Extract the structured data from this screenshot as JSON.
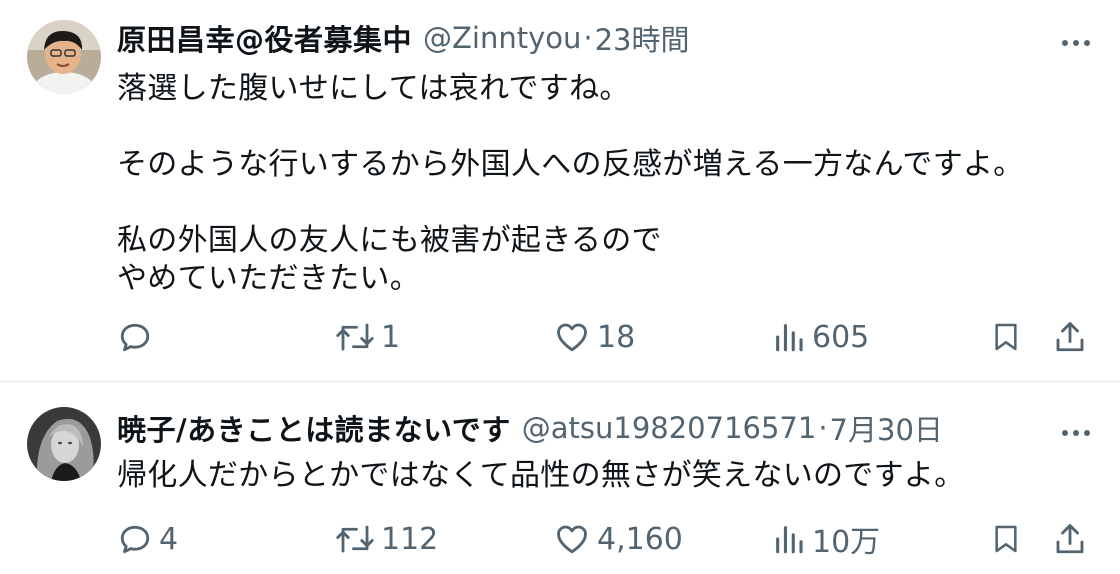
{
  "tweets": [
    {
      "name": "原田昌幸@役者募集中",
      "handle": "@Zinntyou",
      "separator": "·",
      "time": "23時間",
      "text": "落選した腹いせにしては哀れですね。\n\nそのような行いするから外国人への反感が増える一方なんですよ。\n\n私の外国人の友人にも被害が起きるので\nやめていただきたい。",
      "replies": "",
      "retweets": "1",
      "likes": "18",
      "views": "605"
    },
    {
      "name": "暁子/あきことは読まないです",
      "handle": "@atsu19820716571",
      "separator": "·",
      "time": "7月30日",
      "text": "帰化人だからとかではなくて品性の無さが笑えないのですよ。",
      "replies": "4",
      "retweets": "112",
      "likes": "4,160",
      "views": "10万"
    }
  ],
  "icons": {
    "reply": "reply-icon",
    "retweet": "retweet-icon",
    "like": "heart-icon",
    "views": "views-icon",
    "bookmark": "bookmark-icon",
    "share": "share-icon",
    "more": "more-icon"
  },
  "colors": {
    "text": "#0f1419",
    "secondary": "#536471",
    "divider": "#eff3f4"
  }
}
